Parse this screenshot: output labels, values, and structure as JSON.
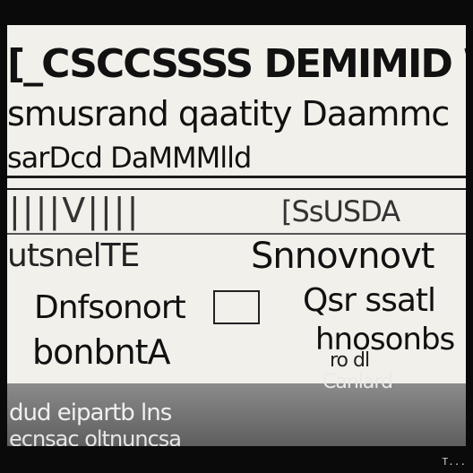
{
  "header": {
    "line1": "[_CSCCSSSS DEMIMID WRcn",
    "line2": "smusrand qaatity Daammc",
    "line3": "sarDcd DaMMMlld"
  },
  "body": {
    "bar_text_left": "||||V||||",
    "bar_text_right": "[SsUSDA",
    "row1_left": "utsnelTE",
    "row1_right": "Snnovnovt",
    "row2_left": "Dnfsonort",
    "row2_right": "Qsr ssatl",
    "row3_left": "bonbntA",
    "row3_right": "hnosonbs",
    "row4_right": "ro dl",
    "row5_right": "Canlard"
  },
  "footer": {
    "line1": "dud eipartb lns",
    "line2": "ecnsac oltnuncsa"
  },
  "corner_text": "T..."
}
